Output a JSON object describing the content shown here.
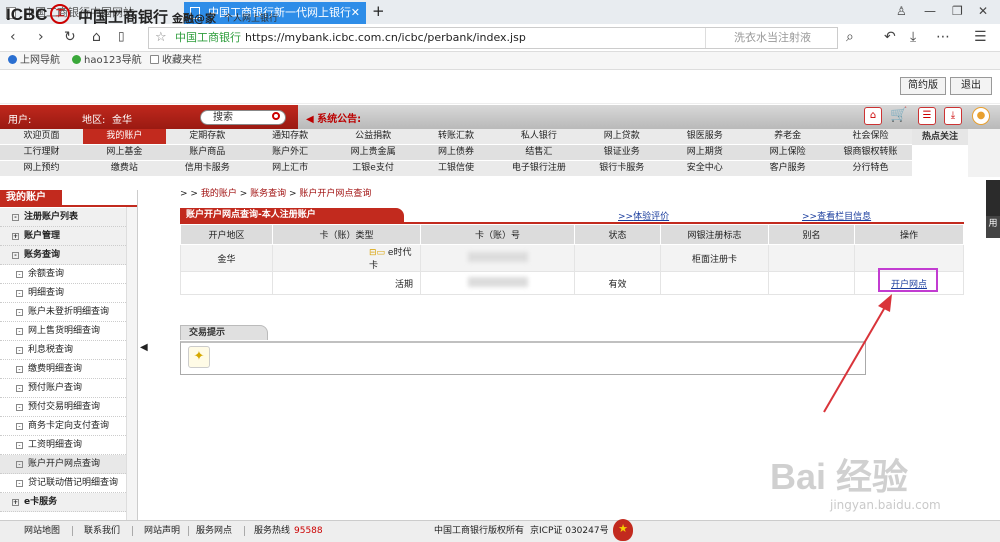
{
  "browser": {
    "tabs": [
      {
        "label": "中国工商银行中国网站"
      },
      {
        "label": "中国工商银行新一代网上银行"
      }
    ],
    "new_tab_glyph": "+",
    "url_title": "中国工商银行",
    "url": "https://mybank.icbc.com.cn/icbc/perbank/index.jsp",
    "search_placeholder": "洗衣水当注射液",
    "bookmarks": [
      "上网导航",
      "hao123导航",
      "收藏夹栏"
    ]
  },
  "header": {
    "logo": "ICBC",
    "seal": "工",
    "bank_name": "中国工商银行",
    "brand": "金融@家",
    "subtitle": "个人网上银行",
    "simple_btn": "简约版",
    "exit_btn": "退出"
  },
  "userbar": {
    "user_label": "用户:",
    "region_label": "地区:",
    "region_value": "金华",
    "search_label": "搜索",
    "notice_label": "系统公告:"
  },
  "menu": {
    "rows": [
      [
        "欢迎页面",
        "我的账户",
        "定期存款",
        "通知存款",
        "公益捐款",
        "转账汇款",
        "私人银行",
        "网上贷款",
        "银医服务",
        "养老金",
        "社会保险"
      ],
      [
        "工行理财",
        "网上基金",
        "账户商品",
        "账户外汇",
        "网上贵金属",
        "网上债券",
        "结售汇",
        "银证业务",
        "网上期货",
        "网上保险",
        "银商银权转账"
      ],
      [
        "网上预约",
        "缴费站",
        "信用卡服务",
        "网上汇市",
        "工银e支付",
        "工银信使",
        "电子银行注册",
        "银行卡服务",
        "安全中心",
        "客户服务",
        "分行特色"
      ]
    ],
    "active": "我的账户",
    "hot": "热点关注"
  },
  "sidebar": {
    "title": "我的账户",
    "items": [
      {
        "label": "注册账户列表",
        "sign": "-"
      },
      {
        "label": "账户管理",
        "sign": "+"
      },
      {
        "label": "账务查询",
        "sign": "-"
      },
      {
        "label": "余额查询",
        "sign": "-"
      },
      {
        "label": "明细查询",
        "sign": "-"
      },
      {
        "label": "账户未登折明细查询",
        "sign": "-"
      },
      {
        "label": "网上售货明细查询",
        "sign": "-"
      },
      {
        "label": "利息税查询",
        "sign": "-"
      },
      {
        "label": "缴费明细查询",
        "sign": "-"
      },
      {
        "label": "预付账户查询",
        "sign": "-"
      },
      {
        "label": "预付交易明细查询",
        "sign": "-"
      },
      {
        "label": "商务卡定向支付查询",
        "sign": "-"
      },
      {
        "label": "工资明细查询",
        "sign": "-"
      },
      {
        "label": "账户开户网点查询",
        "sign": "-"
      },
      {
        "label": "贷记联动借记明细查询",
        "sign": "-"
      },
      {
        "label": "e卡服务",
        "sign": "+"
      }
    ]
  },
  "breadcrumb": {
    "prefix": "> >",
    "items": [
      "我的账户",
      "账务查询",
      "账户开户网点查询"
    ]
  },
  "panel": {
    "title": "账户开户网点查询-本人注册账户",
    "link1": "体验评价",
    "link2": "查看栏目信息",
    "columns": [
      "开户地区",
      "卡（账）类型",
      "卡（账）号",
      "状态",
      "网银注册标志",
      "别名",
      "操作"
    ],
    "rows": [
      {
        "region": "金华",
        "type": "e时代卡",
        "status": "",
        "reg": "柜面注册卡",
        "alias": "",
        "op": ""
      },
      {
        "region": "",
        "type": "活期",
        "status": "有效",
        "reg": "",
        "alias": "",
        "op": "开户网点"
      }
    ]
  },
  "tips": {
    "title": "交易提示"
  },
  "footer": {
    "links": [
      "网站地图",
      "联系我们",
      "网站声明",
      "服务网点",
      "服务热线"
    ],
    "hotline": "95588",
    "copyright": "中国工商银行版权所有",
    "icp": "京ICP证 030247号"
  },
  "watermark": {
    "main": "Bai 经验",
    "sub": "jingyan.baidu.com"
  },
  "edge_widget": "用",
  "colors": {
    "brand_red": "#c22a1e",
    "highlight": "#c23cd1",
    "arrow": "#d9343a"
  }
}
